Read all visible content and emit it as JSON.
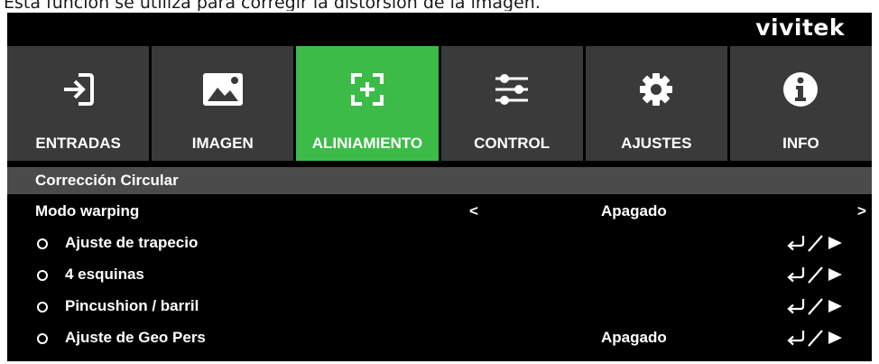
{
  "caption": "Esta función se utiliza para corregir la distorsión de la imagen.",
  "brand": "vivitek",
  "colors": {
    "active_tab": "#3dbb48",
    "tab": "#3a3a3a",
    "section": "#4b4b4b"
  },
  "tabs": [
    {
      "label": "ENTRADAS",
      "icon": "input-arrow-icon",
      "active": false
    },
    {
      "label": "IMAGEN",
      "icon": "picture-icon",
      "active": false
    },
    {
      "label": "ALINIAMIENTO",
      "icon": "alignment-icon",
      "active": true
    },
    {
      "label": "CONTROL",
      "icon": "sliders-icon",
      "active": false
    },
    {
      "label": "AJUSTES",
      "icon": "gear-icon",
      "active": false
    },
    {
      "label": "INFO",
      "icon": "info-icon",
      "active": false
    }
  ],
  "section": {
    "title": "Corrección Circular"
  },
  "warping": {
    "label": "Modo warping",
    "prev": "<",
    "value": "Apagado",
    "next": ">"
  },
  "items": [
    {
      "label": "Ajuste de trapecio",
      "value": ""
    },
    {
      "label": "4 esquinas",
      "value": ""
    },
    {
      "label": "Pincushion / barril",
      "value": ""
    },
    {
      "label": "Ajuste de Geo Pers",
      "value": "Apagado"
    }
  ]
}
